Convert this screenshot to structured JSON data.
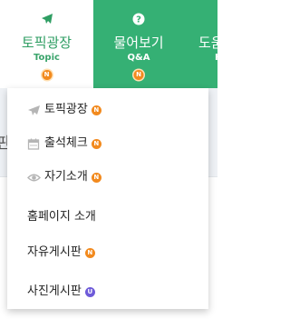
{
  "nav": {
    "tabs": [
      {
        "title": "토픽광장",
        "subtitle": "Topic",
        "badge": "N"
      },
      {
        "title": "물어보기",
        "subtitle": "Q&A",
        "badge": "N"
      },
      {
        "title": "도움",
        "subtitle": "H"
      }
    ]
  },
  "dropdown": {
    "items": [
      {
        "label": "토픽광장",
        "icon": "paper-plane-icon",
        "badge": "N"
      },
      {
        "label": "출석체크",
        "icon": "calendar-icon",
        "badge": "N"
      },
      {
        "label": "자기소개",
        "icon": "eye-icon",
        "badge": "N"
      },
      {
        "label": "홈페이지 소개"
      },
      {
        "label": "자유게시판",
        "badge": "N"
      },
      {
        "label": "사진게시판",
        "badge": "U"
      }
    ]
  },
  "page": {
    "partial_heading": "판"
  },
  "colors": {
    "brand_green": "#35b074",
    "badge_orange": "#f28a1e",
    "badge_purple": "#6e5bd9"
  }
}
